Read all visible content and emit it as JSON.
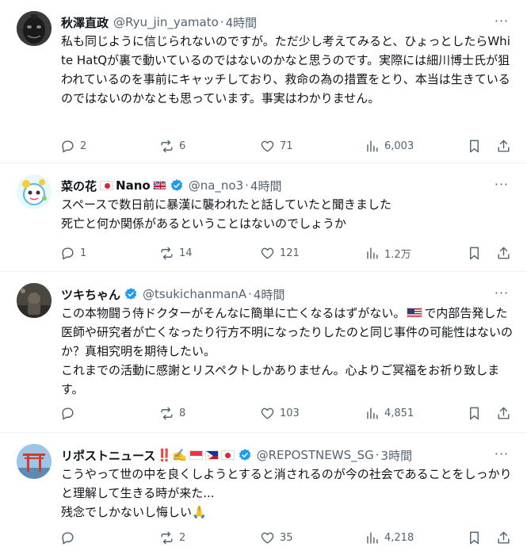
{
  "tweets": [
    {
      "name": "秋澤直政",
      "handle": "@Ryu_jin_yamato",
      "dot": "·",
      "time": "4時間",
      "text": "私も同じように信じられないのですが。ただ少し考えてみると、ひょっとしたらWhite HatQが裏で動いているのではないのかなと思うのです。実際には細川博士氏が狙われているのを事前にキャッチしており、救命の為の措置をとり、本当は生きているのではないのかなとも思っています。事実はわかりません。",
      "replies": "2",
      "reposts": "6",
      "likes": "71",
      "views": "6,003"
    },
    {
      "name": "菜の花",
      "name_suffix": "Nano",
      "handle": "@na_no3",
      "dot": "·",
      "time": "4時間",
      "text": "スペースで数日前に暴漢に襲われたと話していたと聞きました\n死亡と何か関係があるということはないのでしょうか",
      "replies": "1",
      "reposts": "14",
      "likes": "121",
      "views": "1.2万"
    },
    {
      "name": "ツキちゃん",
      "handle": "@tsukichanmanA",
      "dot": "·",
      "time": "4時間",
      "text_before_flag": "この本物闘う侍ドクターがそんなに簡単に亡くなるはずがない。",
      "text_after_flag": "で内部告発した医師や研究者が亡くなったり行方不明になったりしたのと同じ事件の可能性はないのか？真相究明を期待したい。\nこれまでの活動に感謝とリスペクトしかありません。心よりご冥福をお祈り致します。",
      "replies": "",
      "reposts": "8",
      "likes": "103",
      "views": "4,851"
    },
    {
      "name": "リポストニュース",
      "name_emoji": "‼️✍️",
      "handle": "@REPOSTNEWS_SG",
      "dot": "·",
      "time": "3時間",
      "text": "こうやって世の中を良くしようとすると消されるのが今の社会であることをしっかりと理解して生きる時が来た...\n残念でしかないし悔しい🙏",
      "replies": "",
      "reposts": "2",
      "likes": "35",
      "views": "4,218"
    }
  ],
  "more_label": "···",
  "colors": {
    "text": "#0f1419",
    "secondary": "#536471",
    "verified": "#1d9bf0",
    "divider": "#eff3f4"
  },
  "icons": [
    "reply-icon",
    "repost-icon",
    "like-icon",
    "views-icon",
    "bookmark-icon",
    "share-icon",
    "verified-badge-icon",
    "more-icon"
  ]
}
